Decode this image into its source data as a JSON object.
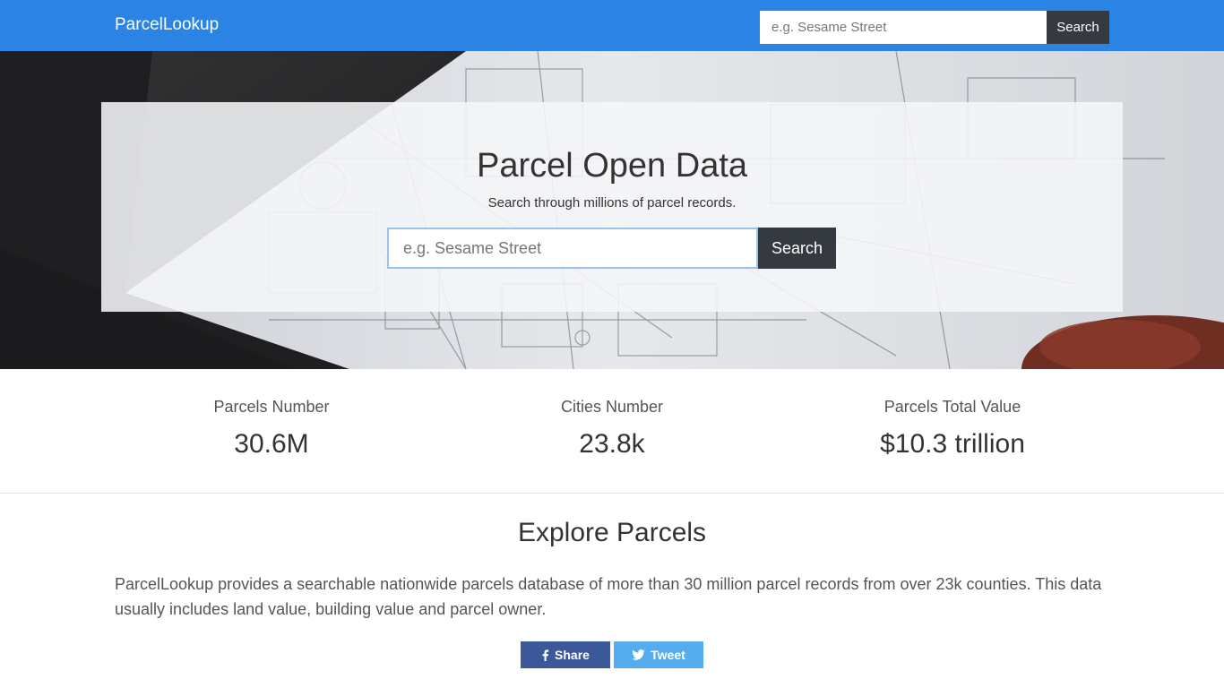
{
  "navbar": {
    "brand": "ParcelLookup",
    "search_placeholder": "e.g. Sesame Street",
    "search_button": "Search",
    "background_color": "#2b84e3"
  },
  "hero": {
    "title": "Parcel Open Data",
    "subtitle": "Search through millions of parcel records.",
    "search_placeholder": "e.g. Sesame Street",
    "search_button": "Search"
  },
  "stats": [
    {
      "label": "Parcels Number",
      "value": "30.6M"
    },
    {
      "label": "Cities Number",
      "value": "23.8k"
    },
    {
      "label": "Parcels Total Value",
      "value": "$10.3 trillion"
    }
  ],
  "explore": {
    "title": "Explore Parcels",
    "text": "ParcelLookup provides a searchable nationwide parcels database of more than 30 million parcel records from over 23k counties. This data usually includes land value, building value and parcel owner."
  },
  "share": {
    "facebook_label": "Share",
    "facebook_icon": "facebook-icon",
    "facebook_color": "#3b5998",
    "twitter_label": "Tweet",
    "twitter_icon": "twitter-icon",
    "twitter_color": "#55acee"
  }
}
